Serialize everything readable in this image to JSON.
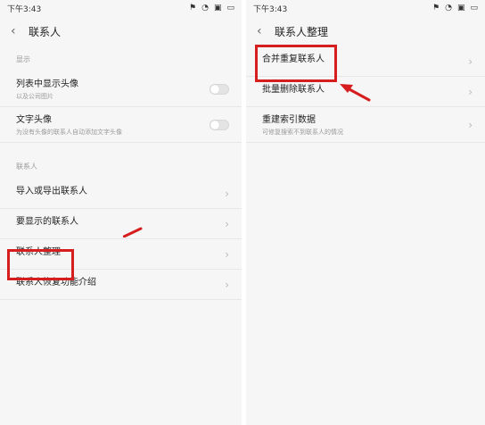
{
  "left": {
    "status_time": "下午3:43",
    "header_title": "联系人",
    "section_display": "显示",
    "show_avatar_title": "列表中显示头像",
    "show_avatar_subtitle": "以及公司图片",
    "text_avatar_title": "文字头像",
    "text_avatar_subtitle": "为没有头像的联系人自动添加文字头像",
    "section_contacts": "联系人",
    "import_export": "导入或导出联系人",
    "displayed_contacts": "要显示的联系人",
    "organize_contacts": "联系人整理",
    "restore_intro": "联系人恢复功能介绍"
  },
  "right": {
    "status_time": "下午3:43",
    "header_title": "联系人整理",
    "merge_duplicates": "合并重复联系人",
    "batch_delete": "批量删除联系人",
    "rebuild_index": "重建索引数据",
    "rebuild_index_subtitle": "可修复搜索不到联系人的情况"
  },
  "colors": {
    "highlight": "#d71e1e"
  },
  "icons": {
    "back": "chevron-left-icon",
    "chevron": "chevron-right-icon",
    "arrow": "red-arrow-icon"
  }
}
